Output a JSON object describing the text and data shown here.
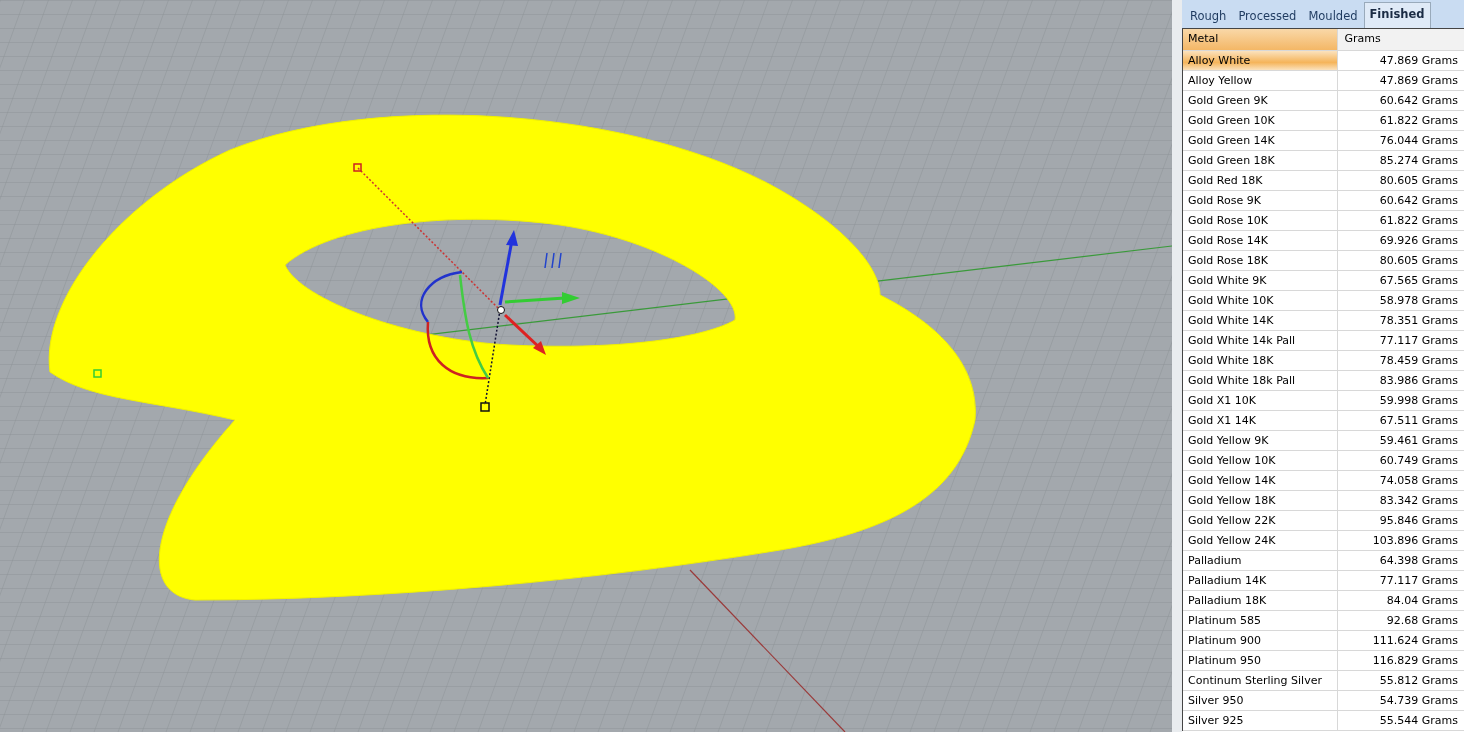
{
  "tabs": [
    {
      "label": "Rough",
      "selected": false
    },
    {
      "label": "Processed",
      "selected": false
    },
    {
      "label": "Moulded",
      "selected": false
    },
    {
      "label": "Finished",
      "selected": true
    }
  ],
  "table": {
    "columns": [
      "Metal",
      "Grams"
    ],
    "rows": [
      {
        "metal": "Alloy White",
        "grams": "47.869 Grams",
        "selected": true
      },
      {
        "metal": "Alloy Yellow",
        "grams": "47.869 Grams",
        "selected": false
      },
      {
        "metal": "Gold Green 9K",
        "grams": "60.642 Grams",
        "selected": false
      },
      {
        "metal": "Gold Green 10K",
        "grams": "61.822 Grams",
        "selected": false
      },
      {
        "metal": "Gold Green 14K",
        "grams": "76.044 Grams",
        "selected": false
      },
      {
        "metal": "Gold Green 18K",
        "grams": "85.274 Grams",
        "selected": false
      },
      {
        "metal": "Gold Red 18K",
        "grams": "80.605 Grams",
        "selected": false
      },
      {
        "metal": "Gold Rose 9K",
        "grams": "60.642 Grams",
        "selected": false
      },
      {
        "metal": "Gold Rose 10K",
        "grams": "61.822 Grams",
        "selected": false
      },
      {
        "metal": "Gold Rose 14K",
        "grams": "69.926 Grams",
        "selected": false
      },
      {
        "metal": "Gold Rose 18K",
        "grams": "80.605 Grams",
        "selected": false
      },
      {
        "metal": "Gold White 9K",
        "grams": "67.565 Grams",
        "selected": false
      },
      {
        "metal": "Gold White 10K",
        "grams": "58.978 Grams",
        "selected": false
      },
      {
        "metal": "Gold White 14K",
        "grams": "78.351 Grams",
        "selected": false
      },
      {
        "metal": "Gold White 14k Pall",
        "grams": "77.117 Grams",
        "selected": false
      },
      {
        "metal": "Gold White 18K",
        "grams": "78.459 Grams",
        "selected": false
      },
      {
        "metal": "Gold White 18k Pall",
        "grams": "83.986 Grams",
        "selected": false
      },
      {
        "metal": "Gold X1 10K",
        "grams": "59.998 Grams",
        "selected": false
      },
      {
        "metal": "Gold X1 14K",
        "grams": "67.511 Grams",
        "selected": false
      },
      {
        "metal": "Gold Yellow 9K",
        "grams": "59.461 Grams",
        "selected": false
      },
      {
        "metal": "Gold Yellow 10K",
        "grams": "60.749 Grams",
        "selected": false
      },
      {
        "metal": "Gold Yellow 14K",
        "grams": "74.058 Grams",
        "selected": false
      },
      {
        "metal": "Gold Yellow 18K",
        "grams": "83.342 Grams",
        "selected": false
      },
      {
        "metal": "Gold Yellow 22K",
        "grams": "95.846 Grams",
        "selected": false
      },
      {
        "metal": "Gold Yellow 24K",
        "grams": "103.896 Grams",
        "selected": false
      },
      {
        "metal": "Palladium",
        "grams": "64.398 Grams",
        "selected": false
      },
      {
        "metal": "Palladium 14K",
        "grams": "77.117 Grams",
        "selected": false
      },
      {
        "metal": "Palladium 18K",
        "grams": "84.04 Grams",
        "selected": false
      },
      {
        "metal": "Platinum 585",
        "grams": "92.68 Grams",
        "selected": false
      },
      {
        "metal": "Platinum 900",
        "grams": "111.624 Grams",
        "selected": false
      },
      {
        "metal": "Platinum 950",
        "grams": "116.829 Grams",
        "selected": false
      },
      {
        "metal": "Continum Sterling Silver",
        "grams": "55.812 Grams",
        "selected": false
      },
      {
        "metal": "Silver 950",
        "grams": "54.739 Grams",
        "selected": false
      },
      {
        "metal": "Silver 925",
        "grams": "55.544 Grams",
        "selected": false
      }
    ]
  }
}
